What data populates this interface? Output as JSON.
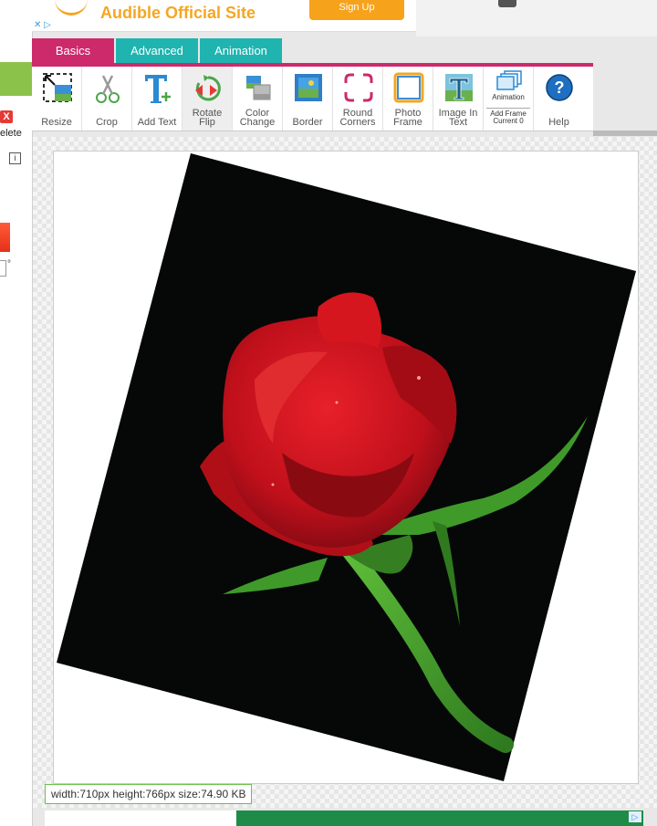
{
  "ad_top": {
    "title": "Audible Official Site",
    "button": "Sign Up",
    "ad_marker": "✕ ▷"
  },
  "sidebar": {
    "delete_icon_label": "X",
    "delete_label": "elete",
    "info_label": "i",
    "degree": "°"
  },
  "tabs": [
    {
      "label": "Basics",
      "active": true
    },
    {
      "label": "Advanced",
      "active": false
    },
    {
      "label": "Animation",
      "active": false
    }
  ],
  "tools": [
    {
      "id": "resize",
      "line1": "Resize",
      "line2": ""
    },
    {
      "id": "crop",
      "line1": "Crop",
      "line2": ""
    },
    {
      "id": "add-text",
      "line1": "Add Text",
      "line2": ""
    },
    {
      "id": "rotate-flip",
      "line1": "Rotate",
      "line2": "Flip"
    },
    {
      "id": "color-change",
      "line1": "Color",
      "line2": "Change"
    },
    {
      "id": "border",
      "line1": "Border",
      "line2": ""
    },
    {
      "id": "round-corners",
      "line1": "Round",
      "line2": "Corners"
    },
    {
      "id": "photo-frame",
      "line1": "Photo",
      "line2": "Frame"
    },
    {
      "id": "image-in-text",
      "line1": "Image In",
      "line2": "Text"
    },
    {
      "id": "animation",
      "title": "Animation",
      "line1": "Add Frame",
      "line2": "Current 0"
    },
    {
      "id": "help",
      "line1": "Help",
      "line2": ""
    }
  ],
  "status": {
    "text": "width:710px  height:766px  size:74.90 KB"
  },
  "colors": {
    "accent": "#cc2a6b",
    "teal": "#1fb4b0",
    "sidebar_green": "#8bc34a"
  }
}
